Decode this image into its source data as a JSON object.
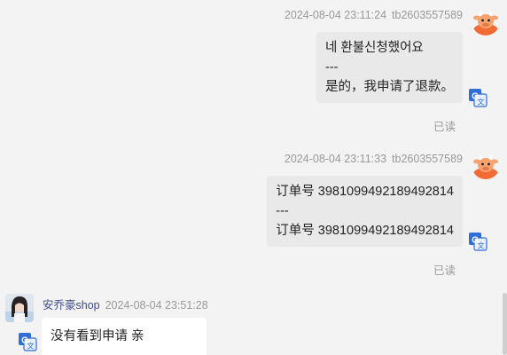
{
  "messages": [
    {
      "timestamp": "2024-08-04 23:11:24",
      "sender": "tb2603557589",
      "lines": [
        "네 환불신청했어요",
        "---",
        "是的，我申请了退款。"
      ],
      "status": "已读"
    },
    {
      "timestamp": "2024-08-04 23:11:33",
      "sender": "tb2603557589",
      "lines": [
        "订单号 3981099492189492814",
        "---",
        "订单号 3981099492189492814"
      ],
      "status": "已读"
    },
    {
      "timestamp": "2024-08-04 23:51:28",
      "sender": "安乔豪shop",
      "lines": [
        "没有看到申请 亲"
      ]
    }
  ],
  "icons": {
    "user_avatar": "cow-avatar-icon",
    "shop_avatar": "shop-avatar",
    "translate": "translate-icon"
  },
  "colors": {
    "background": "#f3f3f3",
    "bubble_self": "#e9e9e9",
    "bubble_other": "#ffffff",
    "shop_name": "#3f4a86",
    "translate_icon": "#2f6fd6"
  }
}
